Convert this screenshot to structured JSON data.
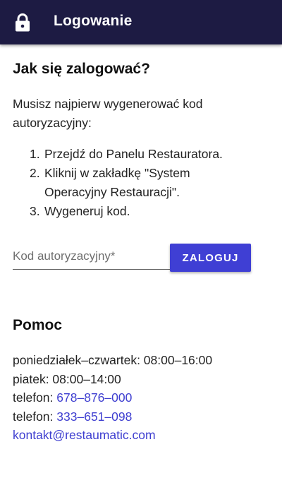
{
  "appbar": {
    "title": "Logowanie",
    "icon": "lock-icon",
    "background": "#1d1b43"
  },
  "instructions": {
    "heading": "Jak się zalogować?",
    "intro": "Musisz najpierw wygenerować kod autoryzacyjny:",
    "steps": [
      {
        "num": "1.",
        "text": "Przejdź do Panelu Restauratora."
      },
      {
        "num": "2.",
        "text": "Kliknij w zakładkę \"System Operacyjny Restauracji\"."
      },
      {
        "num": "3.",
        "text": "Wygeneruj kod."
      }
    ]
  },
  "login": {
    "code_placeholder": "Kod autoryzacyjny*",
    "code_value": "",
    "button_label": "ZALOGUJ",
    "accent": "#3f3fd4"
  },
  "help": {
    "heading": "Pomoc",
    "hours_mon_thu": "poniedziałek–czwartek: 08:00–16:00",
    "hours_fri": "piatek: 08:00–14:00",
    "phone_label_1": "telefon: ",
    "phone_1": "678–876–000",
    "phone_label_2": "telefon: ",
    "phone_2": "333–651–098",
    "email": "kontakt@restaumatic.com",
    "link_color": "#3e3ed0"
  }
}
